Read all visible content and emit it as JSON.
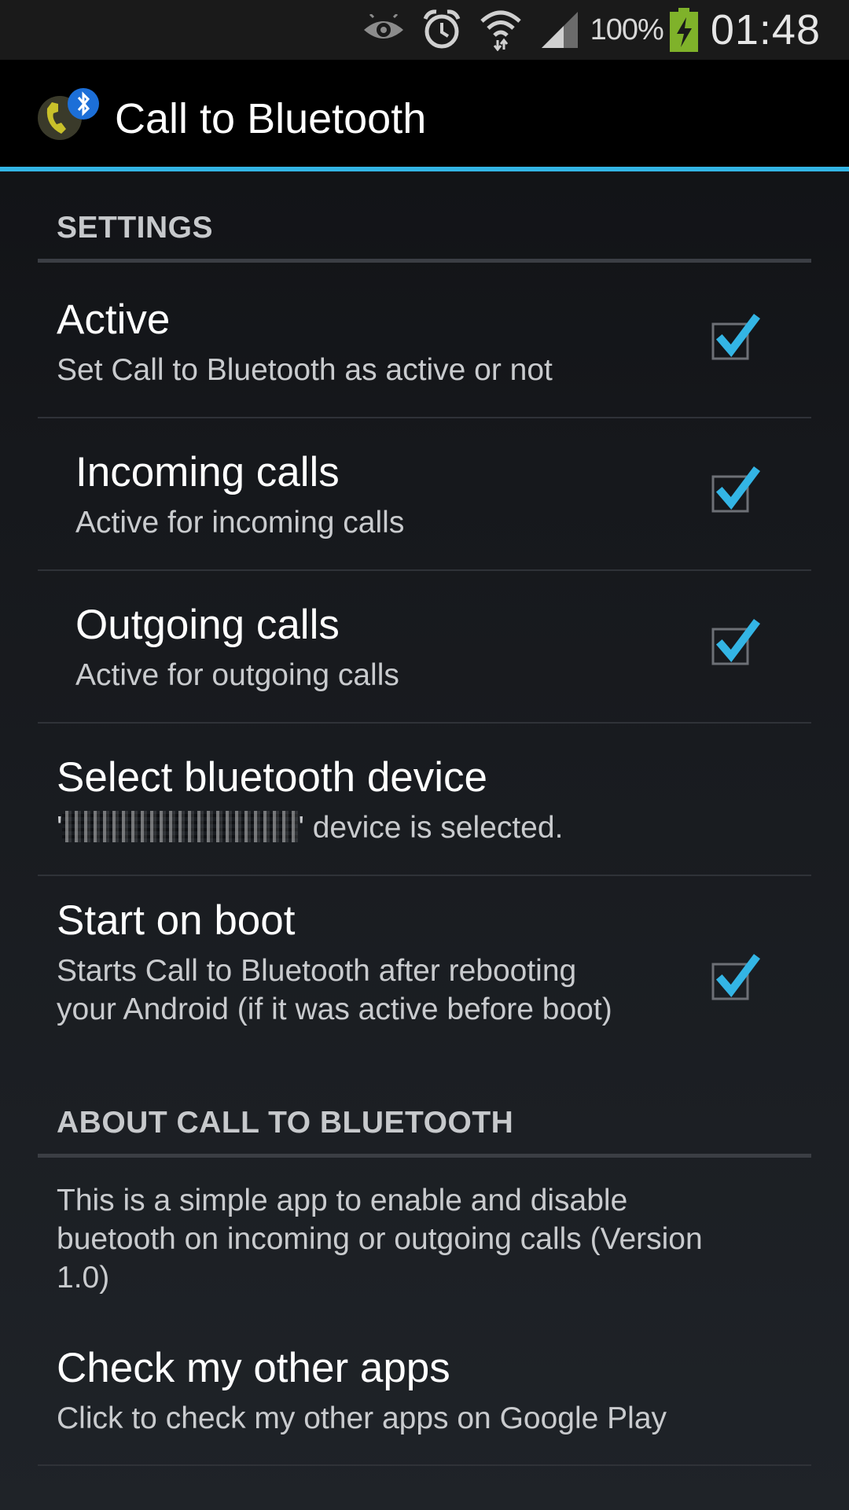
{
  "status_bar": {
    "icons": [
      "eye-icon",
      "alarm-icon",
      "wifi-icon",
      "signal-icon"
    ],
    "battery_percent": "100%",
    "clock": "01:48"
  },
  "action_bar": {
    "app_icon": "phone-bluetooth-icon",
    "title": "Call to Bluetooth"
  },
  "accent_color": "#33b5e5",
  "settings": {
    "header": "SETTINGS",
    "items": [
      {
        "title": "Active",
        "summary": "Set Call to Bluetooth as active or not",
        "checked": true
      },
      {
        "title": "Incoming calls",
        "summary": "Active for incoming calls",
        "checked": true
      },
      {
        "title": "Outgoing calls",
        "summary": "Active for outgoing calls",
        "checked": true
      },
      {
        "title": "Select bluetooth device",
        "summary_open": "'",
        "summary_close": "' device is selected."
      },
      {
        "title": "Start on boot",
        "summary": "Starts Call to Bluetooth after rebooting your Android (if it was active before boot)",
        "checked": true
      }
    ]
  },
  "about": {
    "header": "ABOUT CALL TO BLUETOOTH",
    "description": "This is a simple app to enable and disable buetooth on incoming or outgoing calls (Version 1.0)",
    "other_apps": {
      "title": "Check my other apps",
      "summary": "Click to check my other apps on Google Play"
    }
  }
}
